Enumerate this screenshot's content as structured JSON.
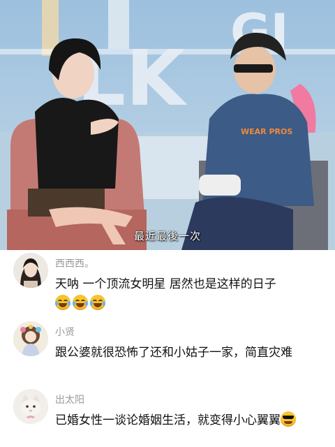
{
  "video": {
    "subtitle": "最近最後一次",
    "jacket_print": "WEAR PROS"
  },
  "comments": [
    {
      "username": "西西西。",
      "text": "天呐 一个顶流女明星 居然也是这样的日子",
      "emoji": [
        "crying-laughing-emoji",
        "crying-laughing-emoji",
        "crying-laughing-emoji"
      ]
    },
    {
      "username": "小贤",
      "text": "跟公婆就很恐怖了还和小姑子一家，简直灾难"
    },
    {
      "username": "出太阳",
      "text": "已婚女性一谈论婚姻生活，就变得小心翼翼",
      "emoji": [
        "sunglasses-emoji"
      ]
    }
  ],
  "colors": {
    "username": "#9a9a9a",
    "comment_text": "#111111",
    "background": "#ffffff"
  }
}
